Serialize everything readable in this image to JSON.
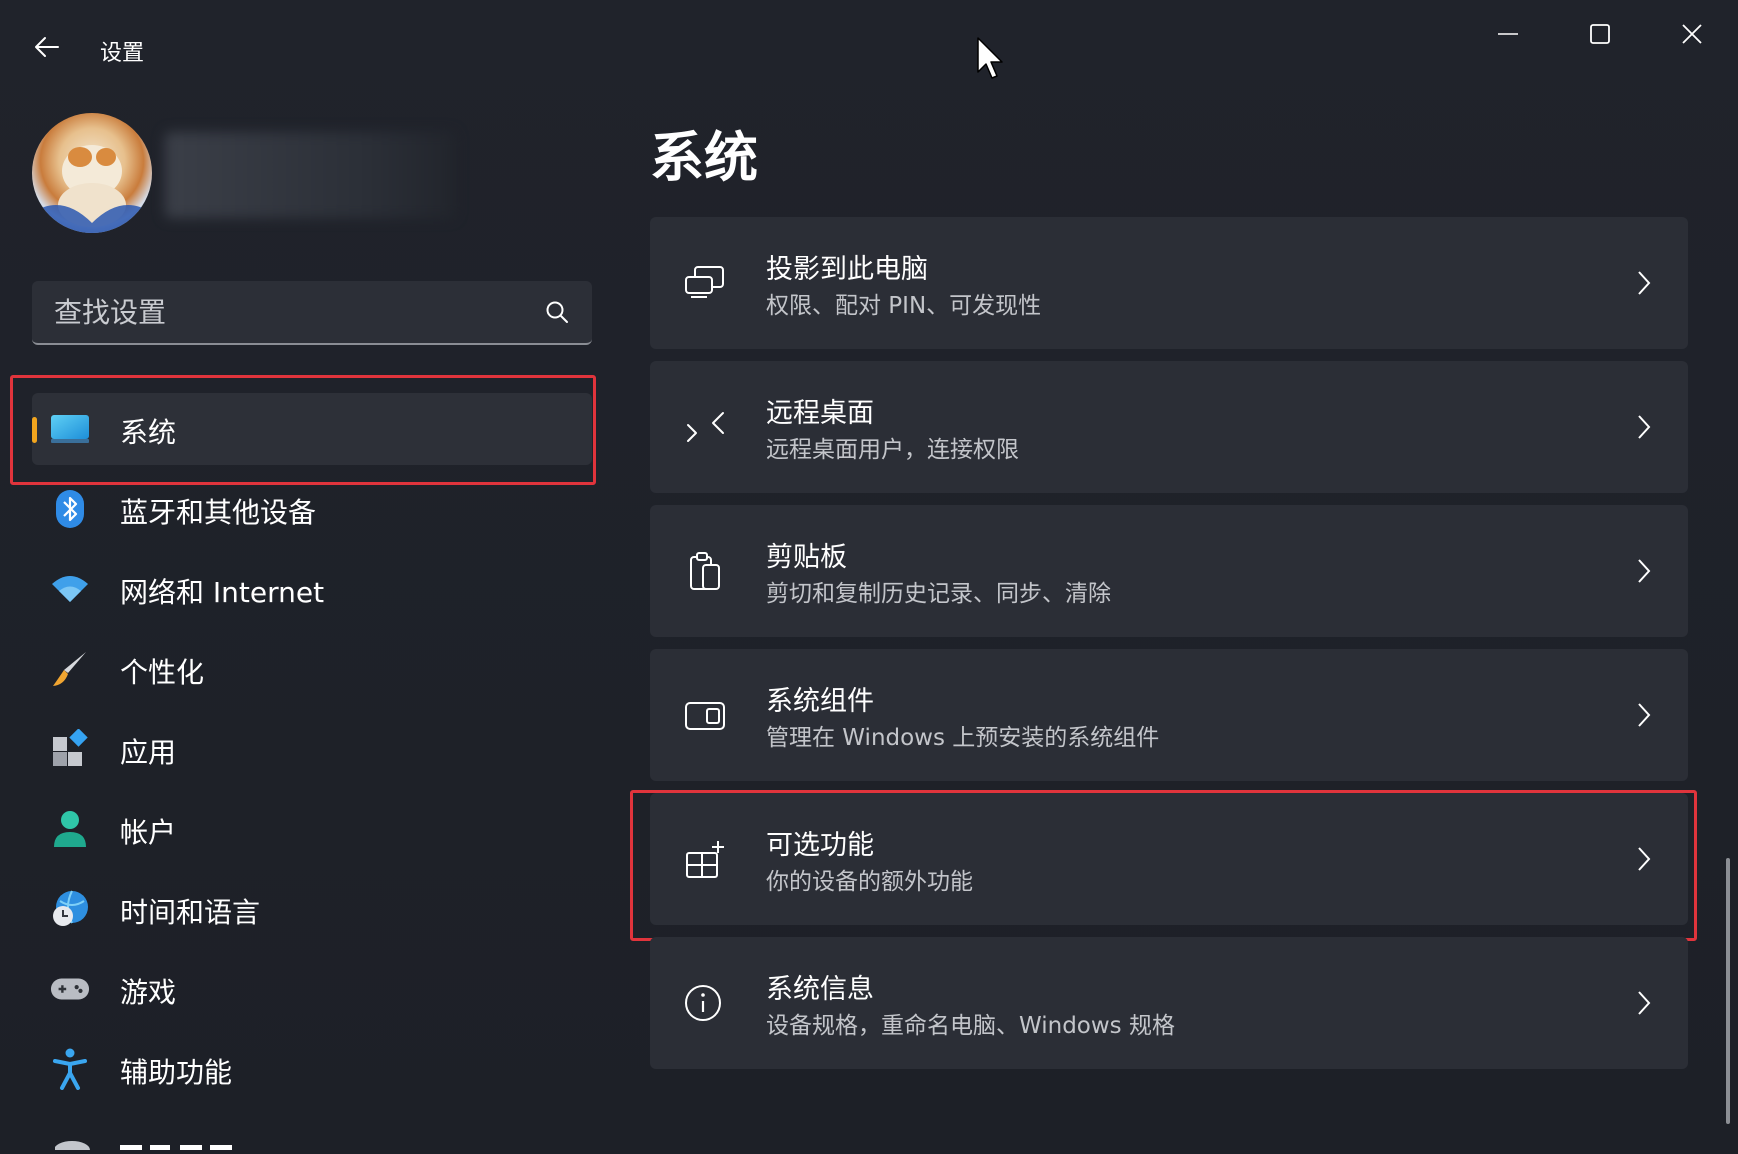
{
  "app": {
    "title": "设置"
  },
  "search": {
    "placeholder": "查找设置"
  },
  "nav": {
    "items": [
      {
        "label": "系统",
        "icon": "system-monitor-icon",
        "active": true
      },
      {
        "label": "蓝牙和其他设备",
        "icon": "bluetooth-icon"
      },
      {
        "label": "网络和 Internet",
        "icon": "wifi-icon"
      },
      {
        "label": "个性化",
        "icon": "paintbrush-icon"
      },
      {
        "label": "应用",
        "icon": "apps-icon"
      },
      {
        "label": "帐户",
        "icon": "account-icon"
      },
      {
        "label": "时间和语言",
        "icon": "time-language-icon"
      },
      {
        "label": "游戏",
        "icon": "gamepad-icon"
      },
      {
        "label": "辅助功能",
        "icon": "accessibility-icon"
      }
    ]
  },
  "main": {
    "title": "系统",
    "cards": [
      {
        "title": "投影到此电脑",
        "subtitle": "权限、配对 PIN、可发现性",
        "icon": "project-icon"
      },
      {
        "title": "远程桌面",
        "subtitle": "远程桌面用户，连接权限",
        "icon": "remote-desktop-icon"
      },
      {
        "title": "剪贴板",
        "subtitle": "剪切和复制历史记录、同步、清除",
        "icon": "clipboard-icon"
      },
      {
        "title": "系统组件",
        "subtitle": "管理在 Windows 上预安装的系统组件",
        "icon": "system-components-icon"
      },
      {
        "title": "可选功能",
        "subtitle": "你的设备的额外功能",
        "icon": "optional-features-icon",
        "highlighted": true
      },
      {
        "title": "系统信息",
        "subtitle": "设备规格，重命名电脑、Windows 规格",
        "icon": "info-icon"
      }
    ]
  },
  "colors": {
    "background": "#1e2129",
    "card": "#2b2e36",
    "accent": "#f2a51e",
    "highlight": "#e0343c"
  }
}
